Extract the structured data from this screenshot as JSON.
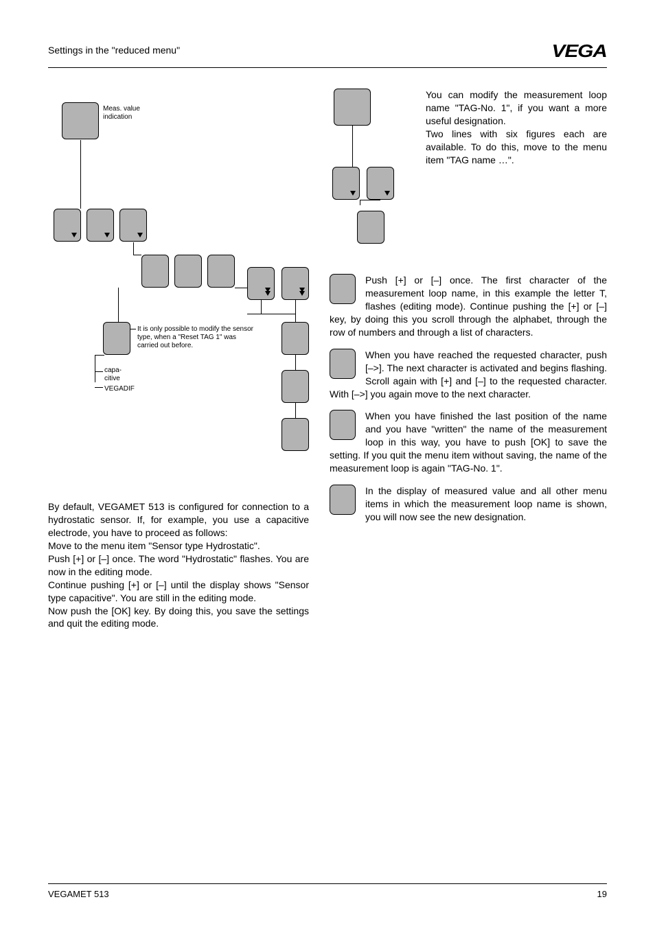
{
  "header": {
    "title": "Settings in the \"reduced menu\"",
    "logo": "VEGA"
  },
  "left": {
    "labels": {
      "meas_value": "Meas. value indication",
      "note": "It is only possible to modify the sensor type, when a \"Reset TAG 1\" was carried out before.",
      "capacitive": "capa-\ncitive",
      "vegadif": "VEGADIF"
    },
    "body": {
      "p1": "By default, VEGAMET 513 is configured for connection to a hydrostatic sensor. If, for example, you use a capacitive electrode, you have to proceed as follows:",
      "p2": "Move to the menu item \"Sensor type Hydrostatic\".",
      "p3": "Push [+] or [–] once. The word \"Hydrostatic\" flashes. You are now in the editing mode.",
      "p4": "Continue pushing [+] or [–] until the display shows \"Sensor type capacitive\". You are still in the editing mode.",
      "p5": "Now push the [OK] key. By doing this, you save the settings and quit the editing mode."
    }
  },
  "right": {
    "intro": "You can modify the measurement loop name \"TAG-No. 1\", if you want a more useful designation.\nTwo lines with six figures each are available. To do this, move to the menu item \"TAG name …\".",
    "steps": {
      "s1": "Push [+] or [–] once. The first character of the measurement loop name, in this example the letter T, flashes (editing mode). Continue pushing the [+] or [–] key, by doing this you scroll through the alphabet, through the row of numbers and through a list of characters.",
      "s2": "When you have reached the requested character, push [–>]. The next character is activated and begins flashing. Scroll again with [+] and [–] to the requested character. With [–>] you again move to the next character.",
      "s3": "When you have finished the last position of the name and you have \"written\" the name of the measurement loop in this way, you have to push [OK] to save the setting. If you quit the menu item without saving, the name of the measurement loop is again \"TAG-No. 1\".",
      "s4": "In the display of measured value and all other menu items in which the measurement loop name is shown, you will now see the new designation."
    }
  },
  "footer": {
    "product": "VEGAMET 513",
    "page": "19"
  }
}
